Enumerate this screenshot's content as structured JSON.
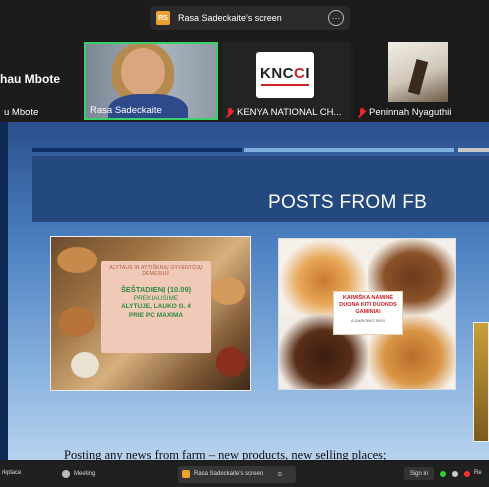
{
  "meeting": {
    "share_badge": "RS",
    "share_title": "Rasa Sadeckaite's screen",
    "more_glyph": "⋯"
  },
  "participants": [
    {
      "name": "u Mbote",
      "big_name": "hau Mbote",
      "muted": false
    },
    {
      "name": "Rasa Sadeckaite",
      "muted": false,
      "active_speaker": true
    },
    {
      "name": "KENYA NATIONAL CH...",
      "muted": true,
      "logo_text": "KNCCI"
    },
    {
      "name": "Peninnah Nyaguthii",
      "muted": true
    }
  ],
  "slide": {
    "title": "POSTS FROM FB",
    "poster1": {
      "line1": "ALYTAUS IR AYTIŠKNIŲ GYVENTOJŲ DĖMESIUI!",
      "line2": "ŠEŠTADIENĮ (10.09)",
      "line3": "PREKIAUSIME",
      "line4": "ALYTUJE, LAUKO G. 4",
      "line5": "PRIE PC MAXIMA"
    },
    "poster2": {
      "line1": "KAIMIŠKA NAMINĖ DUONA KITI DUONOS GAMINIAI",
      "line2": "A.DARIONIO ŪKIS"
    },
    "caption": "Posting any news from farm – new products, new selling places;"
  },
  "taskbar": {
    "left_label": "rkplace",
    "meeting_label": "Meeting",
    "share_label": "Rasa Sadeckaite's screen",
    "signin_label": "Sign in",
    "tray_label": "Re"
  },
  "colors": {
    "active_speaker_border": "#3ad16a",
    "muted_mic": "#e23",
    "slide_header": "#23497e"
  }
}
